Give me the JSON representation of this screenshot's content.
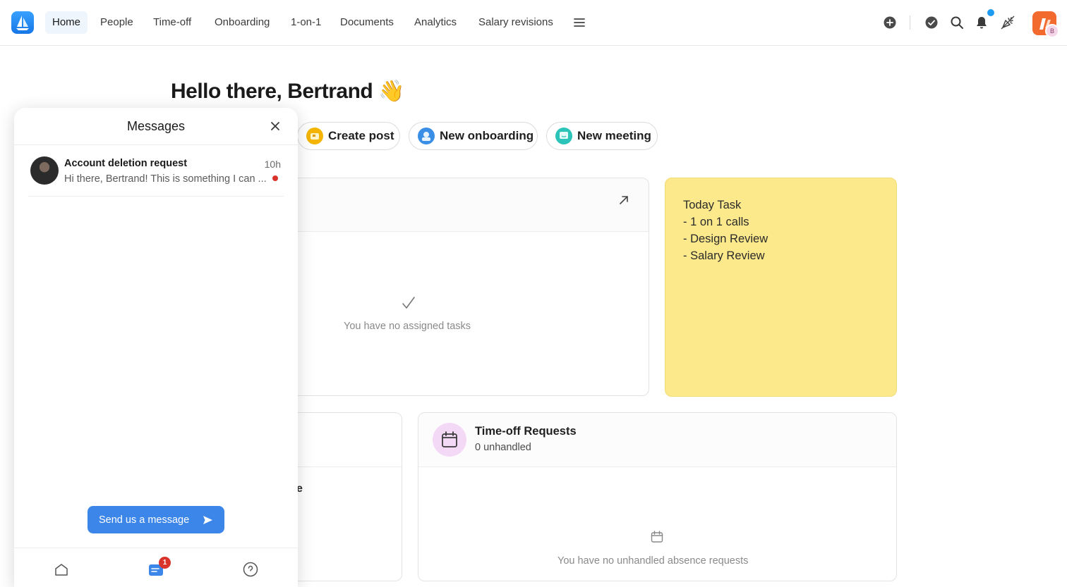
{
  "nav": {
    "items": [
      {
        "label": "Home",
        "active": true
      },
      {
        "label": "People"
      },
      {
        "label": "Time-off"
      },
      {
        "label": "Onboarding"
      },
      {
        "label": "1-on-1"
      },
      {
        "label": "Documents"
      },
      {
        "label": "Analytics"
      },
      {
        "label": "Salary revisions"
      }
    ],
    "icons": [
      "menu-icon",
      "add-circle-icon",
      "check-circle-icon",
      "search-icon",
      "bell-icon",
      "celebration-icon"
    ],
    "avatar_initial": "B",
    "colors": {
      "accent": "#3b86e8",
      "notification": "#1e9bf0",
      "brand": "#f26a2e"
    }
  },
  "main": {
    "greeting": "Hello there, Bertrand 👋",
    "actions": [
      {
        "label": "Create post",
        "color": "#f4b400"
      },
      {
        "label": "New onboarding",
        "color": "#3a8ee6"
      },
      {
        "label": "New meeting",
        "color": "#2cc4b8"
      }
    ],
    "tasks": {
      "empty": "You have no assigned tasks"
    },
    "note": {
      "lines": [
        "Today Task",
        "- 1 on 1 calls",
        "- Design Review",
        "- Salary Review"
      ],
      "color": "#fce98c"
    },
    "partial_card_text": "e",
    "timeoff": {
      "title": "Time-off Requests",
      "subtitle": "0 unhandled",
      "empty": "You have no unhandled absence requests"
    }
  },
  "messages": {
    "title": "Messages",
    "items": [
      {
        "title": "Account deletion request",
        "time": "10h",
        "preview": "Hi there, Bertrand! This is something I can ...",
        "unread": true
      }
    ],
    "send_label": "Send us a message",
    "footer_badge": "1"
  }
}
